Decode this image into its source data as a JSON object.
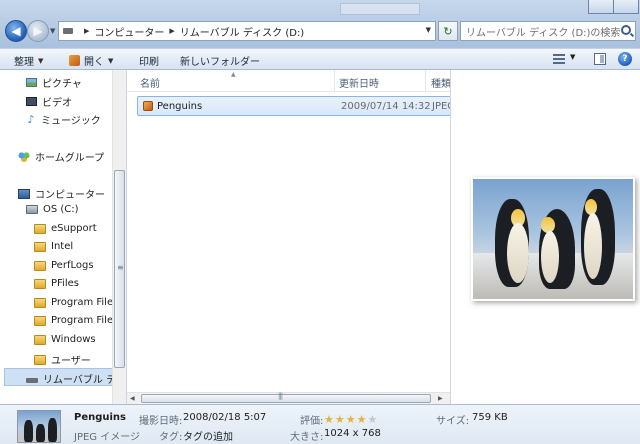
{
  "address": {
    "crumbs": [
      "コンピューター",
      "リムーバブル ディスク (D:)"
    ]
  },
  "search": {
    "placeholder": "リムーバブル ディスク (D:)の検索"
  },
  "toolbar": {
    "organize": "整理",
    "open": "開く",
    "print": "印刷",
    "new_folder": "新しいフォルダー"
  },
  "nav": {
    "libraries": [
      "ピクチャ",
      "ビデオ",
      "ミュージック"
    ],
    "homegroup": "ホームグループ",
    "computer": "コンピューター",
    "os_drive": "OS (C:)",
    "folders": [
      "eSupport",
      "Intel",
      "PerfLogs",
      "PFiles",
      "Program Files",
      "Program Files",
      "Windows",
      "ユーザー"
    ],
    "removable": "リムーバブル デ"
  },
  "columns": {
    "name": "名前",
    "date": "更新日時",
    "type": "種類"
  },
  "files": [
    {
      "name": "Penguins",
      "date": "2009/07/14 14:32",
      "type": "JPEG"
    }
  ],
  "details": {
    "name": "Penguins",
    "kind": "JPEG イメージ",
    "taken_label": "撮影日時:",
    "taken_value": "2008/02/18 5:07",
    "tags_label": "タグ:",
    "tags_value": "タグの追加",
    "rating_label": "評価:",
    "rating": 4,
    "rating_max": 5,
    "dim_label": "大きさ:",
    "dim_value": "1024 x 768",
    "size_label": "サイズ:",
    "size_value": "759 KB"
  },
  "colors": {
    "accent": "#1d5fb8",
    "selection": "#d6e7fb",
    "star": "#e1b43a"
  }
}
